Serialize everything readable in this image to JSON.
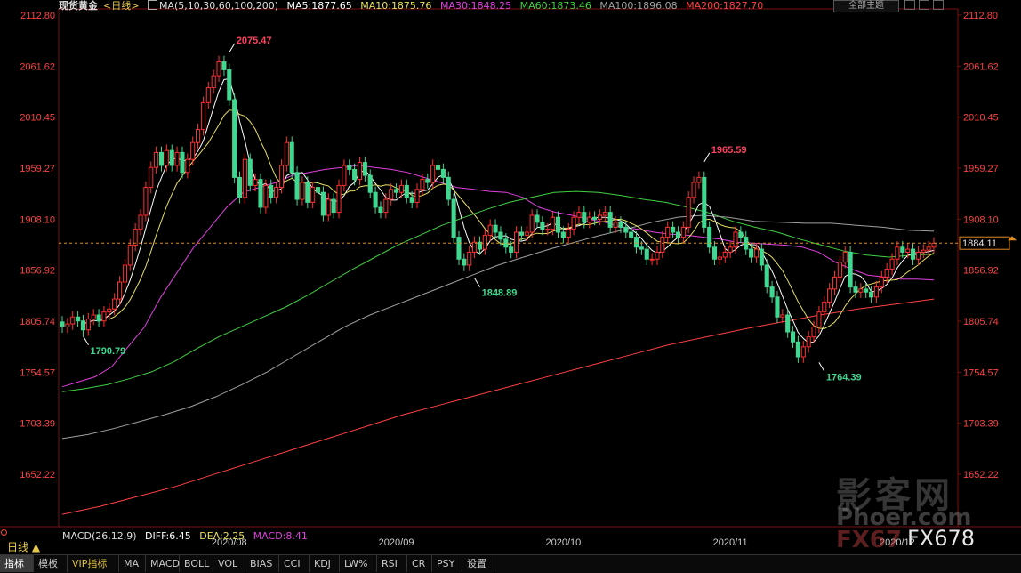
{
  "header": {
    "title": "现货黄金",
    "period_tag": "<日线>",
    "ma_label": "MA(5,10,30,60,100,200)",
    "ma_values": [
      {
        "label": "MA5:1877.65",
        "color": "#ffffff"
      },
      {
        "label": "MA10:1875.76",
        "color": "#e8e060"
      },
      {
        "label": "MA30:1848.25",
        "color": "#e040e0"
      },
      {
        "label": "MA60:1873.46",
        "color": "#40d040"
      },
      {
        "label": "MA100:1896.08",
        "color": "#a0a0a0"
      },
      {
        "label": "MA200:1827.70",
        "color": "#ff4040"
      }
    ],
    "theme_button": "全部主题"
  },
  "price_axis": {
    "ticks": [
      "2112.80",
      "2061.62",
      "2010.45",
      "1959.27",
      "1908.10",
      "1856.92",
      "1805.74",
      "1754.57",
      "1703.39",
      "1652.22"
    ],
    "current_price": "1884.11"
  },
  "time_axis": [
    "2020/08",
    "2020/09",
    "2020/10",
    "2020/11",
    "2020/12"
  ],
  "macd": {
    "label": "MACD(26,12,9)",
    "diff": "DIFF:6.45",
    "dea": "DEA:2.25",
    "macd": "MACD:8.41"
  },
  "period_label": "日线 ▲",
  "bottom_tabs": [
    "指标",
    "模板",
    "VIP指标",
    "MA",
    "MACD",
    "BOLL",
    "VOL",
    "BIAS",
    "CCI",
    "KDJ",
    "LW%",
    "RSI",
    "CR",
    "PSY",
    "设置"
  ],
  "watermark": {
    "line1": "影客网",
    "line2": "Phoer.com",
    "line3": "FX67",
    "line4": "FX678"
  },
  "colors": {
    "up": "#ff3030",
    "down": "#40d890",
    "axis_text": "#ff4040",
    "bg": "#000000"
  },
  "chart_data": {
    "type": "candlestick",
    "title": "现货黄金",
    "ylim": [
      1610,
      2115
    ],
    "y_ticks": [
      2112.8,
      2061.62,
      2010.45,
      1959.27,
      1908.1,
      1856.92,
      1805.74,
      1754.57,
      1703.39,
      1652.22
    ],
    "x_labels": [
      "2020/08",
      "2020/09",
      "2020/10",
      "2020/11",
      "2020/12"
    ],
    "x_label_index": [
      32,
      64,
      96,
      128,
      160
    ],
    "current_price": 1884.11,
    "annotations": [
      {
        "text": "2075.47",
        "index": 32,
        "value": 2075.47,
        "color": "#ff4060"
      },
      {
        "text": "1790.79",
        "index": 4,
        "value": 1790.79,
        "color": "#40d890"
      },
      {
        "text": "1848.89",
        "index": 79,
        "value": 1848.89,
        "color": "#40d890"
      },
      {
        "text": "1965.59",
        "index": 123,
        "value": 1965.59,
        "color": "#ff4060"
      },
      {
        "text": "1764.39",
        "index": 145,
        "value": 1764.39,
        "color": "#40d890"
      }
    ],
    "closes": [
      1800,
      1803,
      1810,
      1806,
      1797,
      1808,
      1812,
      1806,
      1815,
      1818,
      1828,
      1845,
      1862,
      1882,
      1898,
      1912,
      1940,
      1960,
      1975,
      1962,
      1977,
      1962,
      1975,
      1955,
      1968,
      1985,
      1998,
      2025,
      2040,
      2052,
      2066,
      2058,
      2028,
      1950,
      1930,
      1968,
      1942,
      1948,
      1920,
      1942,
      1930,
      1940,
      1962,
      1985,
      1955,
      1928,
      1945,
      1925,
      1940,
      1935,
      1912,
      1928,
      1915,
      1942,
      1962,
      1958,
      1948,
      1965,
      1952,
      1935,
      1920,
      1915,
      1928,
      1938,
      1935,
      1942,
      1930,
      1925,
      1938,
      1948,
      1945,
      1962,
      1958,
      1950,
      1928,
      1890,
      1868,
      1862,
      1875,
      1885,
      1878,
      1892,
      1902,
      1895,
      1888,
      1880,
      1875,
      1895,
      1892,
      1895,
      1912,
      1905,
      1898,
      1898,
      1910,
      1895,
      1890,
      1898,
      1910,
      1915,
      1905,
      1910,
      1908,
      1912,
      1915,
      1900,
      1905,
      1900,
      1895,
      1890,
      1880,
      1878,
      1868,
      1868,
      1875,
      1890,
      1900,
      1895,
      1890,
      1900,
      1930,
      1945,
      1950,
      1900,
      1880,
      1868,
      1870,
      1875,
      1880,
      1895,
      1890,
      1878,
      1870,
      1878,
      1862,
      1840,
      1830,
      1810,
      1812,
      1795,
      1785,
      1770,
      1780,
      1790,
      1800,
      1815,
      1825,
      1838,
      1850,
      1865,
      1875,
      1840,
      1835,
      1838,
      1835,
      1830,
      1840,
      1850,
      1858,
      1868,
      1880,
      1875,
      1878,
      1868,
      1875,
      1877,
      1880,
      1884
    ],
    "opens": [
      1805,
      1800,
      1803,
      1810,
      1806,
      1797,
      1808,
      1812,
      1806,
      1815,
      1818,
      1828,
      1845,
      1862,
      1882,
      1898,
      1912,
      1940,
      1960,
      1975,
      1962,
      1977,
      1962,
      1975,
      1955,
      1968,
      1985,
      1998,
      2025,
      2040,
      2052,
      2066,
      2058,
      2028,
      1950,
      1930,
      1968,
      1942,
      1948,
      1920,
      1942,
      1930,
      1940,
      1962,
      1985,
      1955,
      1928,
      1945,
      1925,
      1940,
      1935,
      1912,
      1928,
      1915,
      1942,
      1962,
      1958,
      1948,
      1965,
      1952,
      1935,
      1920,
      1915,
      1928,
      1938,
      1935,
      1942,
      1930,
      1925,
      1938,
      1948,
      1945,
      1962,
      1958,
      1950,
      1928,
      1890,
      1868,
      1862,
      1875,
      1885,
      1878,
      1892,
      1902,
      1895,
      1888,
      1880,
      1875,
      1895,
      1892,
      1895,
      1912,
      1905,
      1898,
      1898,
      1910,
      1895,
      1890,
      1898,
      1910,
      1915,
      1905,
      1910,
      1908,
      1912,
      1915,
      1900,
      1905,
      1900,
      1895,
      1890,
      1880,
      1878,
      1868,
      1868,
      1875,
      1890,
      1900,
      1895,
      1890,
      1900,
      1930,
      1945,
      1950,
      1900,
      1880,
      1868,
      1870,
      1875,
      1880,
      1895,
      1890,
      1878,
      1870,
      1878,
      1862,
      1840,
      1830,
      1810,
      1812,
      1795,
      1785,
      1770,
      1780,
      1790,
      1800,
      1815,
      1825,
      1838,
      1850,
      1865,
      1875,
      1840,
      1835,
      1838,
      1835,
      1830,
      1840,
      1850,
      1858,
      1868,
      1880,
      1875,
      1878,
      1868,
      1875,
      1877,
      1880
    ],
    "ma_series": [
      {
        "name": "MA5",
        "color": "#ffffff",
        "values": []
      },
      {
        "name": "MA10",
        "color": "#e8e060",
        "values": []
      },
      {
        "name": "MA30",
        "color": "#e040e0",
        "values": [
          1740,
          1745,
          1750,
          1760,
          1780,
          1800,
          1830,
          1855,
          1880,
          1900,
          1920,
          1935,
          1940,
          1945,
          1952,
          1955,
          1958,
          1960,
          1962,
          1960,
          1958,
          1955,
          1950,
          1945,
          1940,
          1938,
          1936,
          1935,
          1930,
          1920,
          1915,
          1912,
          1908,
          1905,
          1900,
          1898,
          1895,
          1893,
          1892,
          1890,
          1888,
          1885,
          1884,
          1883,
          1882,
          1880,
          1875,
          1865,
          1858,
          1852,
          1850,
          1848,
          1848,
          1847
        ]
      },
      {
        "name": "MA60",
        "color": "#40d040",
        "values": [
          1735,
          1738,
          1742,
          1748,
          1755,
          1765,
          1778,
          1790,
          1800,
          1810,
          1820,
          1832,
          1845,
          1858,
          1870,
          1882,
          1892,
          1902,
          1910,
          1918,
          1925,
          1930,
          1935,
          1936,
          1935,
          1932,
          1928,
          1925,
          1920,
          1914,
          1906,
          1900,
          1895,
          1888,
          1882,
          1876,
          1872,
          1870,
          1872,
          1873
        ]
      },
      {
        "name": "MA100",
        "color": "#a0a0a0",
        "values": [
          1688,
          1692,
          1698,
          1705,
          1712,
          1720,
          1730,
          1742,
          1755,
          1770,
          1785,
          1800,
          1812,
          1822,
          1832,
          1842,
          1852,
          1862,
          1870,
          1878,
          1885,
          1892,
          1898,
          1905,
          1910,
          1912,
          1910,
          1906,
          1905,
          1904,
          1904,
          1902,
          1900,
          1897,
          1896
        ]
      },
      {
        "name": "MA200",
        "color": "#ff4040",
        "values": [
          1612,
          1620,
          1630,
          1640,
          1652,
          1664,
          1676,
          1688,
          1700,
          1712,
          1722,
          1732,
          1742,
          1752,
          1762,
          1772,
          1782,
          1790,
          1798,
          1805,
          1812,
          1818,
          1823,
          1828
        ]
      }
    ]
  }
}
